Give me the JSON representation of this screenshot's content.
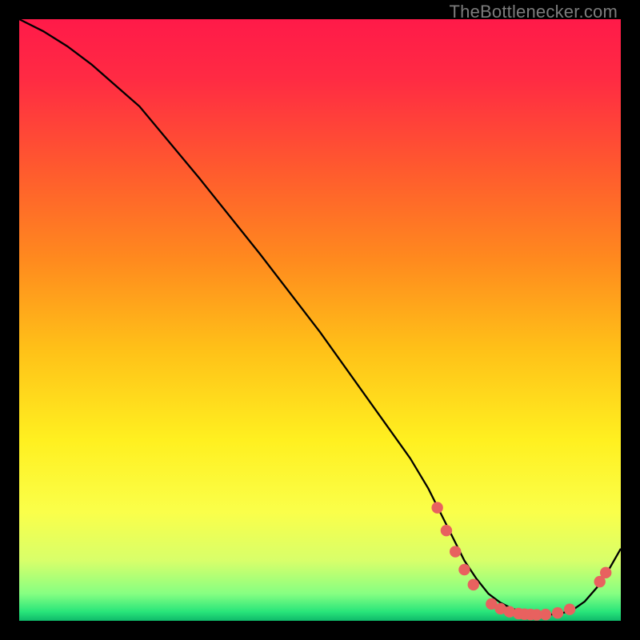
{
  "watermark": "TheBottlenecker.com",
  "chart_data": {
    "type": "line",
    "title": "",
    "xlabel": "",
    "ylabel": "",
    "xlim": [
      0,
      100
    ],
    "ylim": [
      0,
      100
    ],
    "background_gradient": {
      "stops": [
        {
          "offset": 0.0,
          "color": "#ff1a49"
        },
        {
          "offset": 0.1,
          "color": "#ff2b43"
        },
        {
          "offset": 0.25,
          "color": "#ff5a2e"
        },
        {
          "offset": 0.4,
          "color": "#ff8a1e"
        },
        {
          "offset": 0.55,
          "color": "#ffc118"
        },
        {
          "offset": 0.7,
          "color": "#fff020"
        },
        {
          "offset": 0.82,
          "color": "#faff4a"
        },
        {
          "offset": 0.9,
          "color": "#d8ff6a"
        },
        {
          "offset": 0.955,
          "color": "#86ff82"
        },
        {
          "offset": 0.985,
          "color": "#28e57a"
        },
        {
          "offset": 1.0,
          "color": "#0fb96a"
        }
      ]
    },
    "series": [
      {
        "name": "bottleneck-curve",
        "color": "#000000",
        "stroke_width": 2.3,
        "x": [
          0,
          4,
          8,
          12,
          16,
          20,
          30,
          40,
          50,
          60,
          65,
          68,
          70,
          72,
          74,
          76,
          78,
          80,
          82,
          84,
          86,
          88,
          90,
          92,
          94,
          96,
          98,
          100
        ],
        "y": [
          100,
          98,
          95.5,
          92.5,
          89,
          85.5,
          73.5,
          61,
          48,
          34,
          27,
          22,
          18,
          14,
          10,
          7,
          4.5,
          3,
          2,
          1.4,
          1.1,
          1.0,
          1.2,
          1.8,
          3.2,
          5.5,
          8.5,
          12
        ]
      }
    ],
    "markers": [
      {
        "name": "marker",
        "color": "#e8615f",
        "r": 7.2,
        "x": 69.5,
        "y": 18.8
      },
      {
        "name": "marker",
        "color": "#e8615f",
        "r": 7.2,
        "x": 71.0,
        "y": 15.0
      },
      {
        "name": "marker",
        "color": "#e8615f",
        "r": 7.2,
        "x": 72.5,
        "y": 11.5
      },
      {
        "name": "marker",
        "color": "#e8615f",
        "r": 7.2,
        "x": 74.0,
        "y": 8.5
      },
      {
        "name": "marker",
        "color": "#e8615f",
        "r": 7.2,
        "x": 75.5,
        "y": 6.0
      },
      {
        "name": "marker",
        "color": "#e8615f",
        "r": 7.2,
        "x": 78.5,
        "y": 2.8
      },
      {
        "name": "marker",
        "color": "#e8615f",
        "r": 7.2,
        "x": 80.0,
        "y": 2.0
      },
      {
        "name": "marker",
        "color": "#e8615f",
        "r": 7.2,
        "x": 81.5,
        "y": 1.5
      },
      {
        "name": "marker",
        "color": "#e8615f",
        "r": 7.2,
        "x": 83.0,
        "y": 1.2
      },
      {
        "name": "marker",
        "color": "#e8615f",
        "r": 7.2,
        "x": 84.0,
        "y": 1.1
      },
      {
        "name": "marker",
        "color": "#e8615f",
        "r": 7.2,
        "x": 85.0,
        "y": 1.05
      },
      {
        "name": "marker",
        "color": "#e8615f",
        "r": 7.2,
        "x": 86.0,
        "y": 1.0
      },
      {
        "name": "marker",
        "color": "#e8615f",
        "r": 7.2,
        "x": 87.5,
        "y": 1.05
      },
      {
        "name": "marker",
        "color": "#e8615f",
        "r": 7.2,
        "x": 89.5,
        "y": 1.3
      },
      {
        "name": "marker",
        "color": "#e8615f",
        "r": 7.2,
        "x": 91.5,
        "y": 1.9
      },
      {
        "name": "marker",
        "color": "#e8615f",
        "r": 7.2,
        "x": 96.5,
        "y": 6.5
      },
      {
        "name": "marker",
        "color": "#e8615f",
        "r": 7.2,
        "x": 97.5,
        "y": 8.0
      }
    ]
  }
}
